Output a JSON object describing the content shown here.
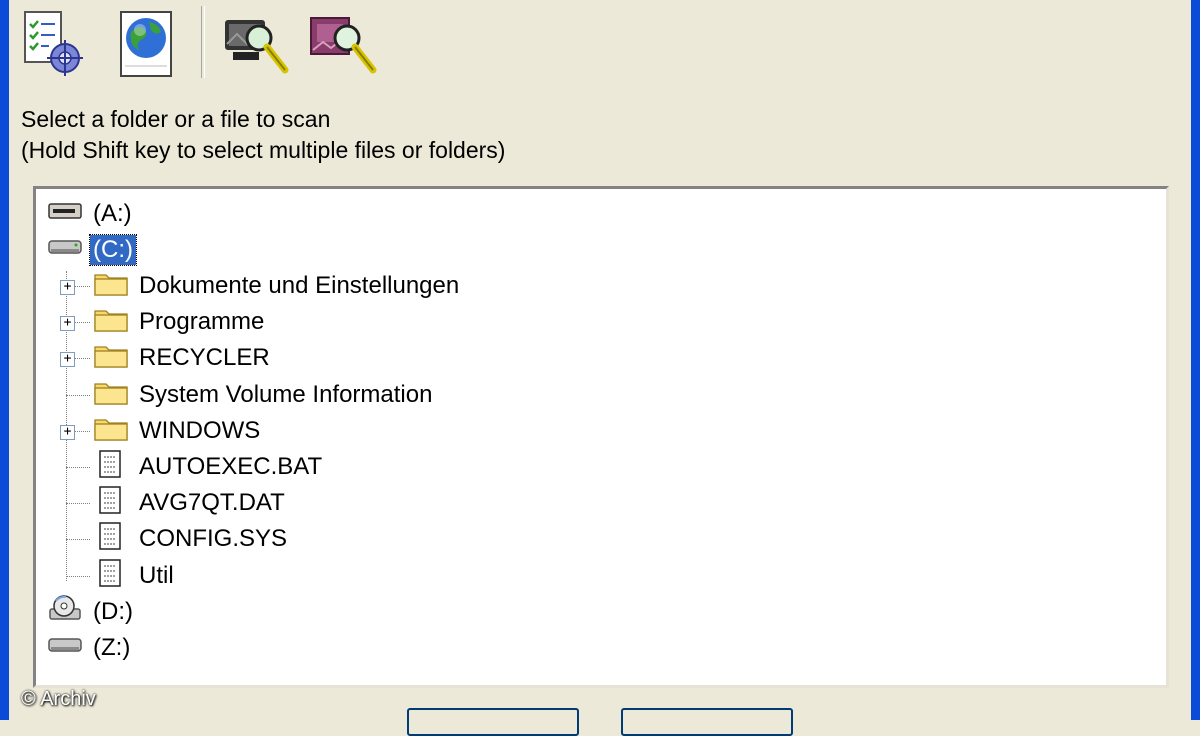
{
  "toolbar": {
    "buttons": [
      {
        "icon": "scan-settings-icon"
      },
      {
        "icon": "web-update-icon"
      },
      {
        "icon": "scan-computer-icon"
      },
      {
        "icon": "scan-selected-icon"
      }
    ]
  },
  "instructions": {
    "line1": "Select a folder or a file to scan",
    "line2": "(Hold Shift key to select multiple files or folders)"
  },
  "tree": {
    "drives": [
      {
        "label": "(A:)",
        "icon": "floppy-drive-icon"
      },
      {
        "label": "(C:)",
        "icon": "hard-drive-icon",
        "selected": true,
        "expanded": true
      },
      {
        "label": "(D:)",
        "icon": "cd-drive-icon"
      },
      {
        "label": "(Z:)",
        "icon": "network-drive-icon"
      }
    ],
    "c_children": [
      {
        "label": "Dokumente und Einstellungen",
        "type": "folder",
        "expandable": true
      },
      {
        "label": "Programme",
        "type": "folder",
        "expandable": true
      },
      {
        "label": "RECYCLER",
        "type": "folder",
        "expandable": true
      },
      {
        "label": "System Volume Information",
        "type": "folder",
        "expandable": false
      },
      {
        "label": "WINDOWS",
        "type": "folder",
        "expandable": true
      },
      {
        "label": "AUTOEXEC.BAT",
        "type": "file",
        "expandable": false
      },
      {
        "label": "AVG7QT.DAT",
        "type": "file",
        "expandable": false
      },
      {
        "label": "CONFIG.SYS",
        "type": "file",
        "expandable": false
      },
      {
        "label": "Util",
        "type": "file",
        "expandable": false
      }
    ]
  },
  "watermark": "© Archiv",
  "colors": {
    "title_bar_blue": "#0a4bd8",
    "dialog_bg": "#ece9d8",
    "selection_bg": "#316ac5",
    "folder_yellow": "#f7d96b"
  }
}
